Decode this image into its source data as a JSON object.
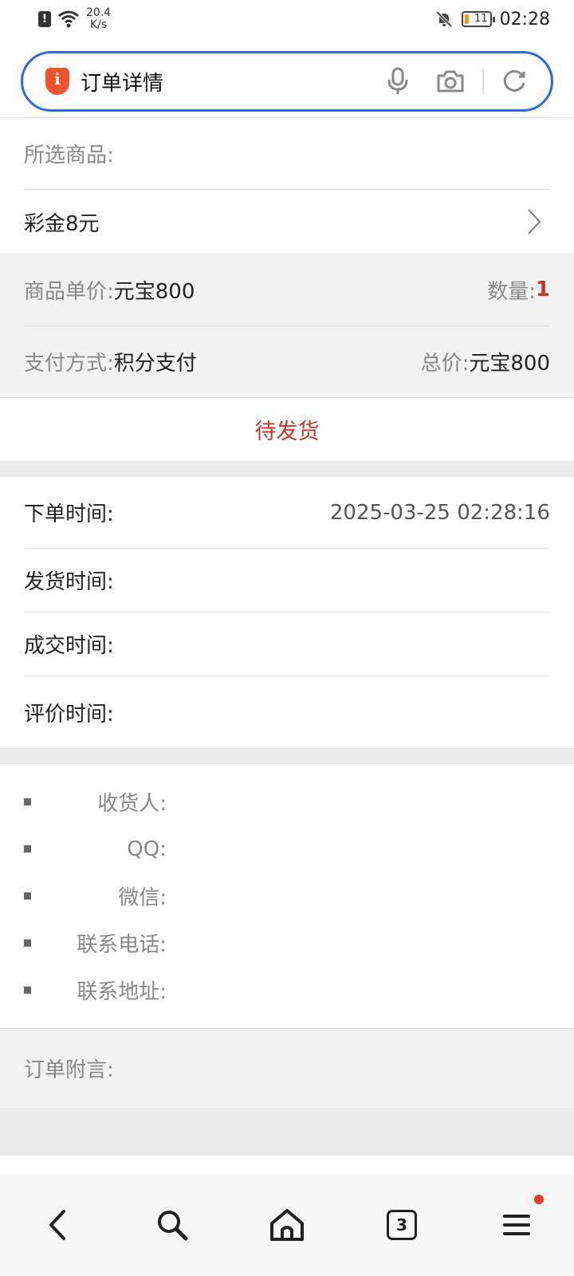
{
  "status_bar": {
    "speed_value": "20.4",
    "speed_unit": "K/s",
    "battery": "11",
    "time": "02:28"
  },
  "search": {
    "text": "订单详情"
  },
  "product": {
    "section_label": "所选商品:",
    "item_name": "彩金8元"
  },
  "price": {
    "unit_price_label": "商品单价:",
    "unit_price_value": "元宝800",
    "quantity_label": "数量:",
    "quantity_value": "1",
    "payment_label": "支付方式:",
    "payment_value": "积分支付",
    "total_label": "总价:",
    "total_value": "元宝800"
  },
  "order_status": "待发货",
  "times": [
    {
      "label": "下单时间:",
      "value": "2025-03-25 02:28:16"
    },
    {
      "label": "发货时间:",
      "value": ""
    },
    {
      "label": "成交时间:",
      "value": ""
    },
    {
      "label": "评价时间:",
      "value": ""
    }
  ],
  "contact": [
    {
      "label": "收货人:"
    },
    {
      "label": "QQ:"
    },
    {
      "label": "微信:"
    },
    {
      "label": "联系电话:"
    },
    {
      "label": "联系地址:"
    }
  ],
  "note": {
    "label": "订单附言:"
  },
  "bottom_nav": {
    "tab_count": "3"
  },
  "colors": {
    "accent_blue": "#2a6ce0",
    "status_red": "#c0392b",
    "shield_orange": "#f0532a",
    "badge_red": "#e83a30"
  }
}
